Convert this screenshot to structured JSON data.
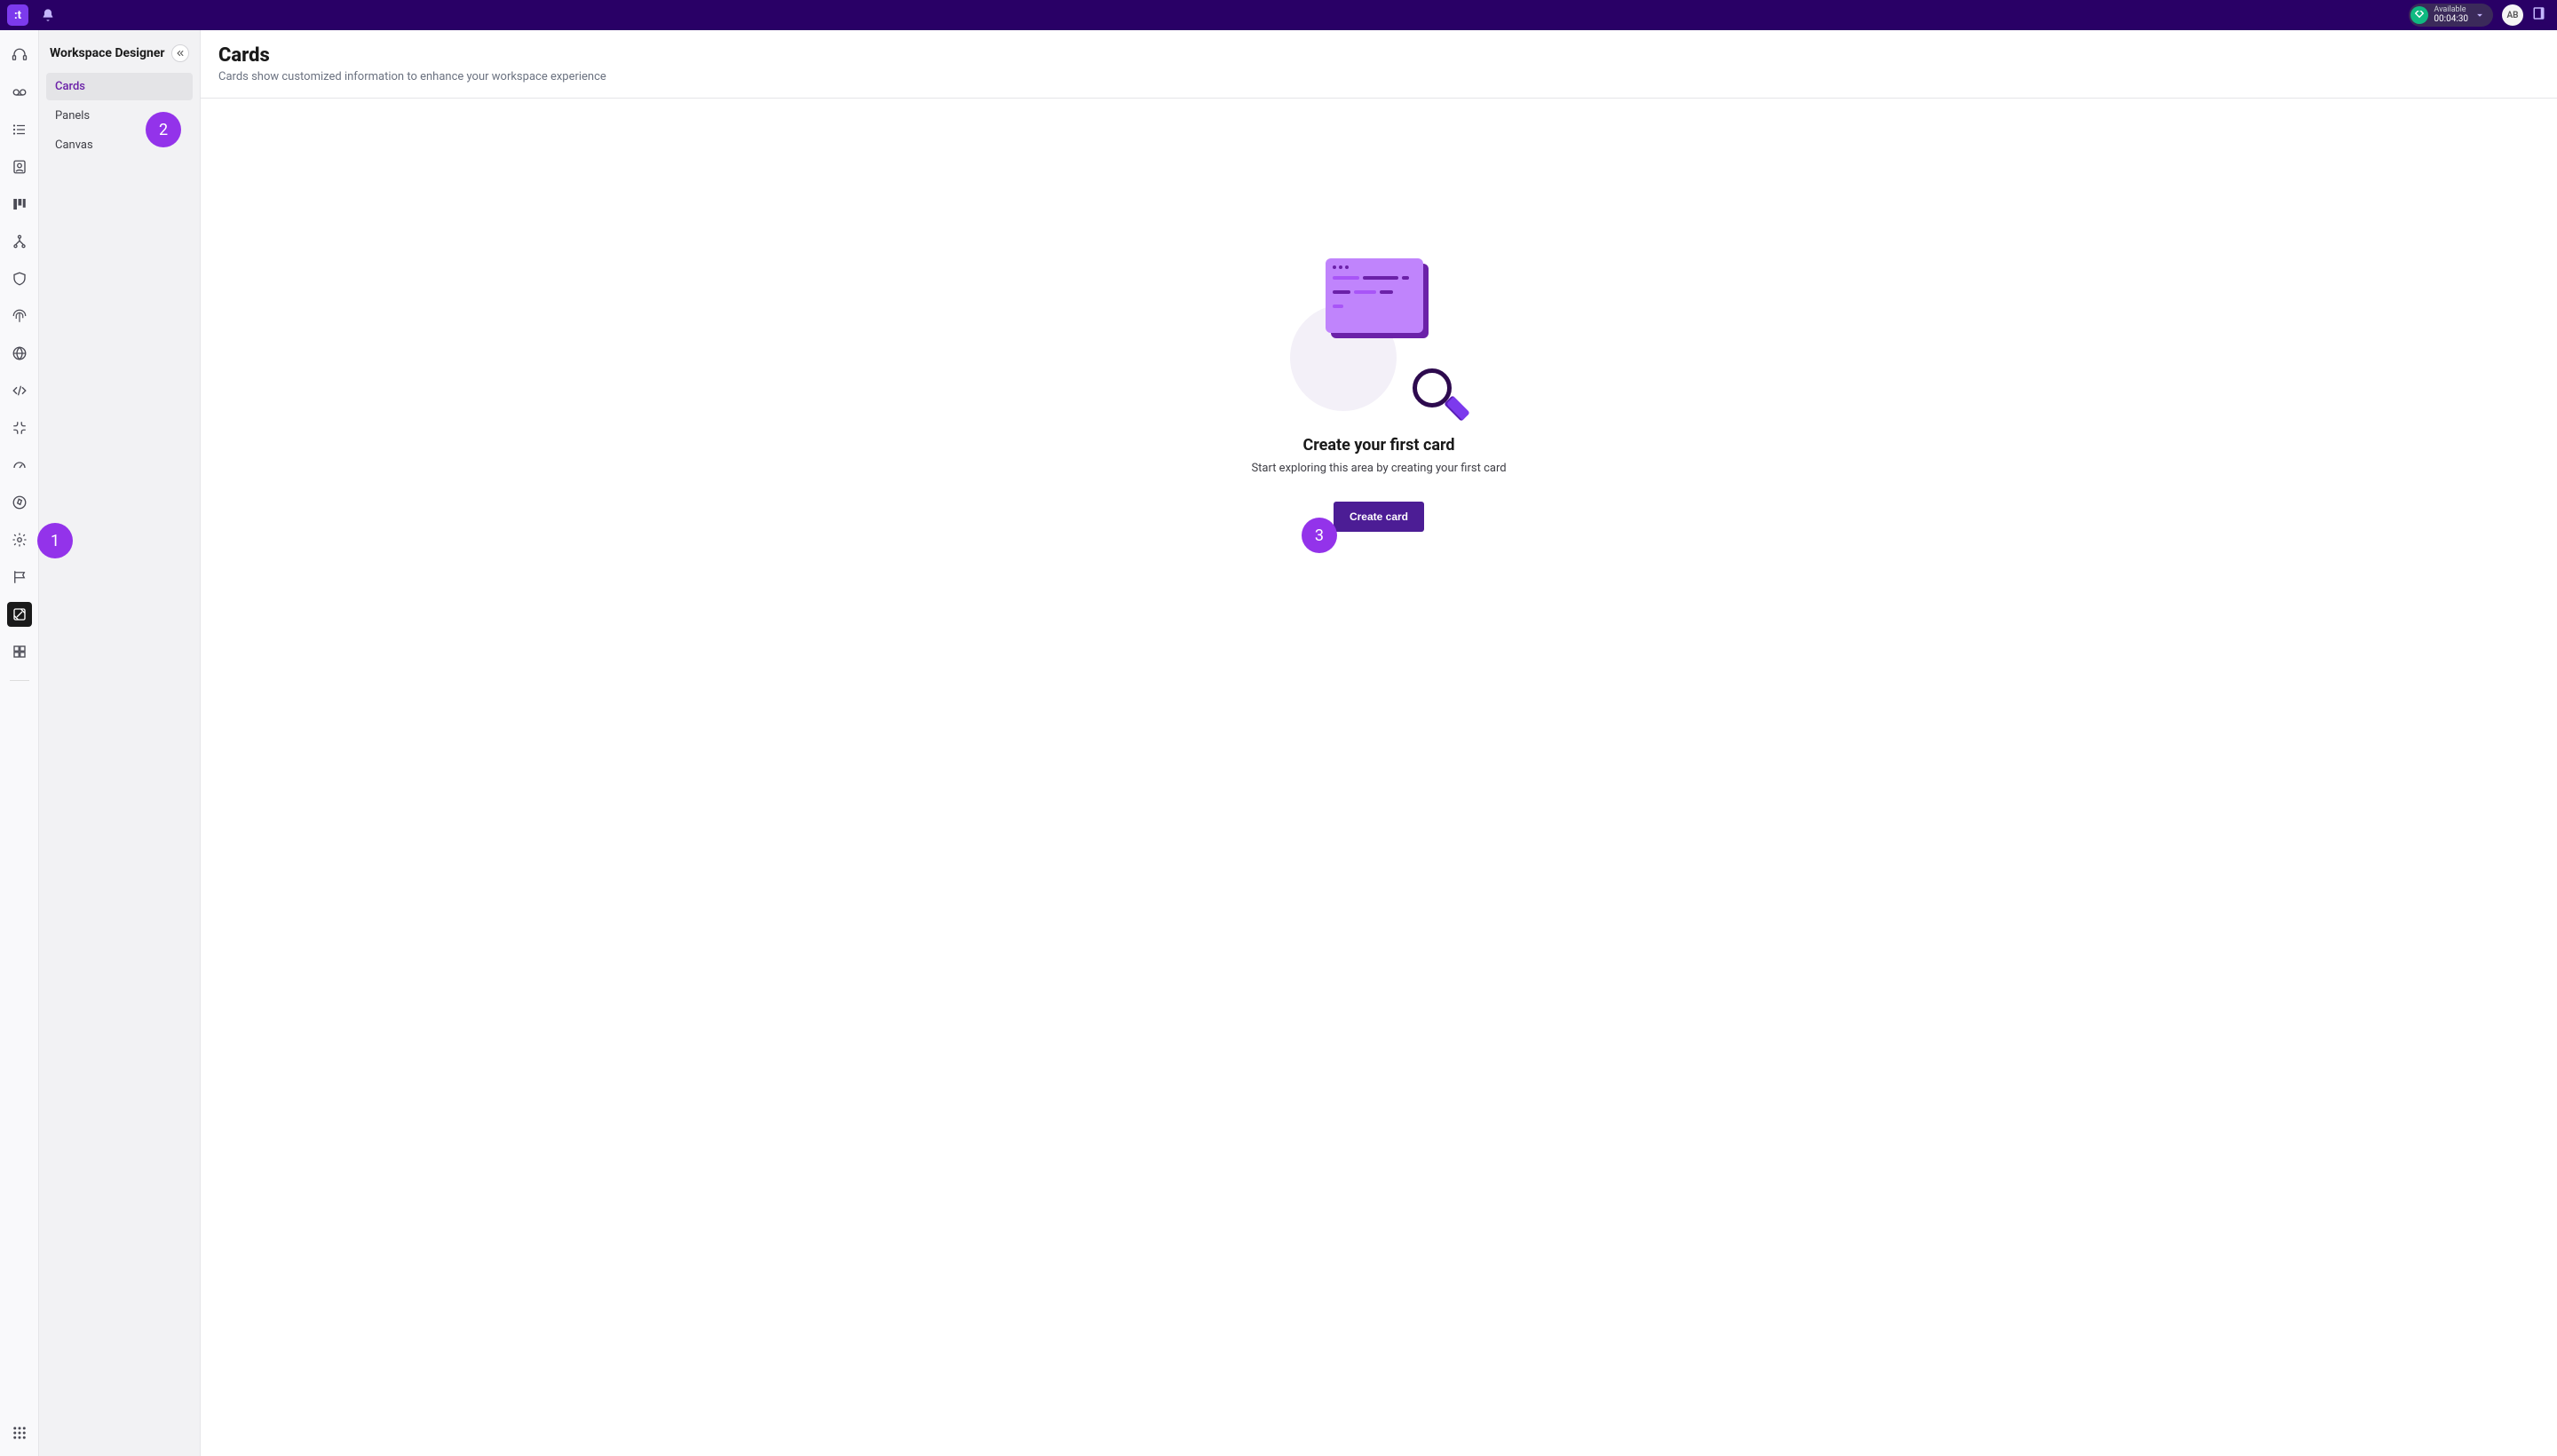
{
  "topbar": {
    "logo_text": ":t",
    "status": {
      "label": "Available",
      "timer": "00:04:30"
    },
    "avatar_initials": "AB"
  },
  "sidebar": {
    "title": "Workspace Designer",
    "items": [
      {
        "label": "Cards",
        "active": true
      },
      {
        "label": "Panels",
        "active": false
      },
      {
        "label": "Canvas",
        "active": false
      }
    ]
  },
  "main": {
    "title": "Cards",
    "description": "Cards show customized information to enhance your workspace experience"
  },
  "empty_state": {
    "title": "Create your first card",
    "subtitle": "Start exploring this area by creating your first card",
    "button_label": "Create card"
  },
  "step_badges": {
    "one": "1",
    "two": "2",
    "three": "3"
  },
  "nav_rail_icons": [
    "headset-icon",
    "voicemail-icon",
    "list-icon",
    "contact-icon",
    "kanban-icon",
    "routing-icon",
    "shield-icon",
    "fingerprint-icon",
    "globe-icon",
    "code-icon",
    "integration-icon",
    "gauge-icon",
    "compass-icon",
    "settings-icon",
    "tickets-icon",
    "designer-icon",
    "apps-grid-icon"
  ]
}
